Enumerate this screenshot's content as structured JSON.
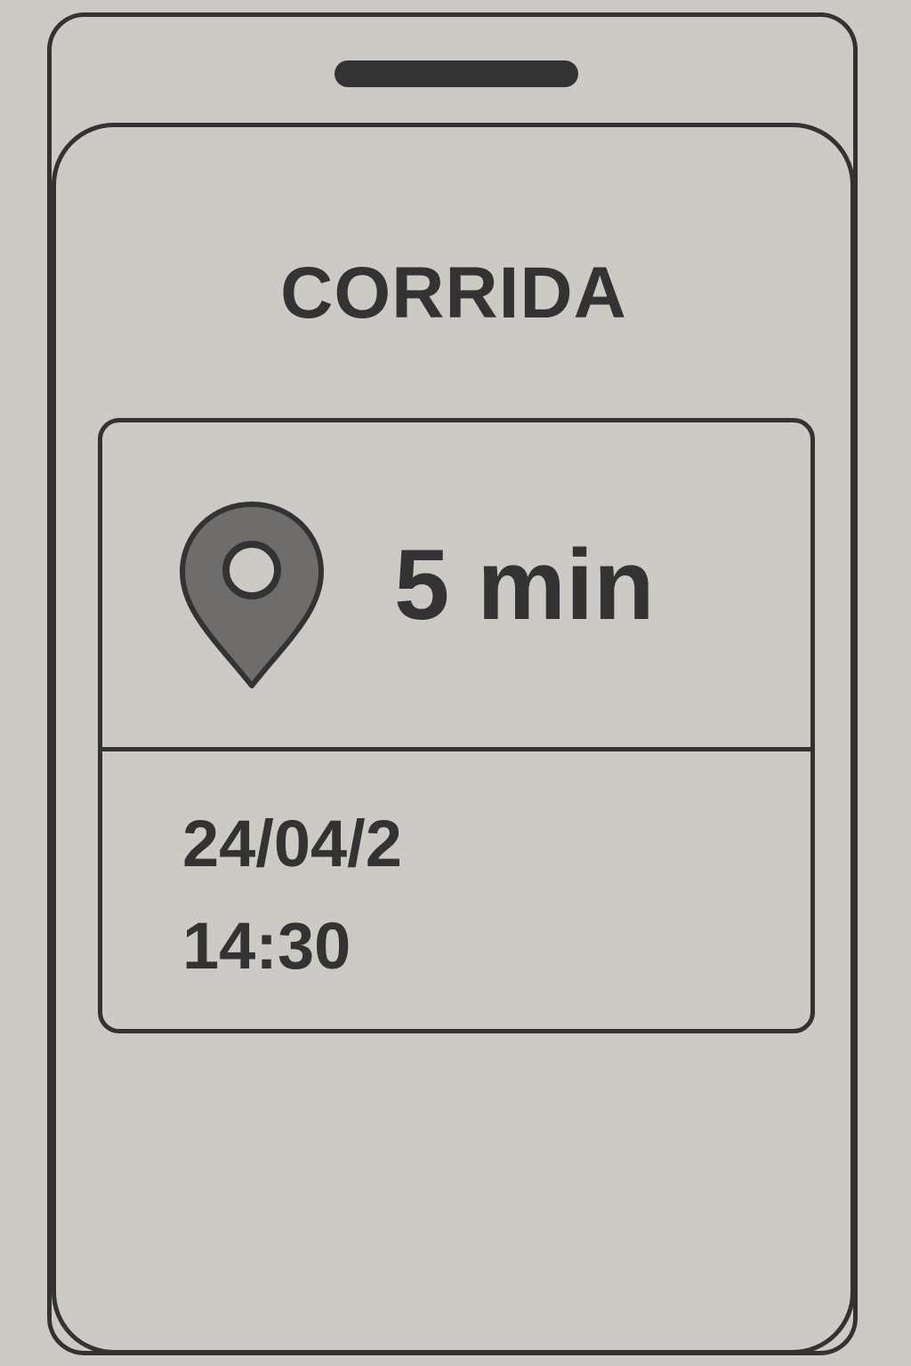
{
  "screen": {
    "title": "CORRIDA"
  },
  "ride_card": {
    "eta": "5 min",
    "date": "24/04/2",
    "time": "14:30",
    "icon": "map-pin-icon"
  },
  "colors": {
    "background": "#cdcac6",
    "ink": "#333333",
    "pin_fill": "#6f6d6b"
  }
}
